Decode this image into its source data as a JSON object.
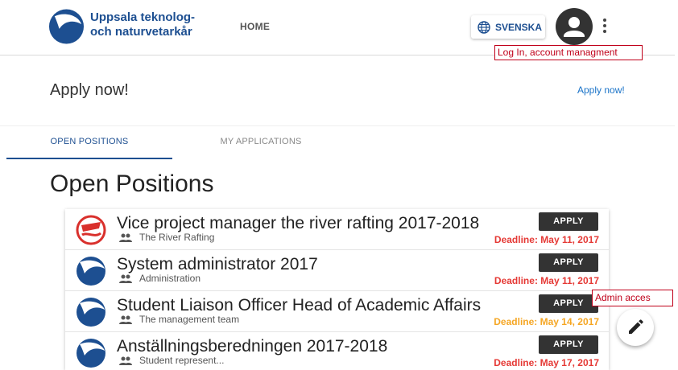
{
  "header": {
    "brand_line1": "Uppsala teknolog-",
    "brand_line2": "och naturvetarkår",
    "nav_home": "HOME",
    "lang_button": "SVENSKA",
    "brand_color": "#1d4f91"
  },
  "annotations": {
    "login": "Log In, account managment",
    "admin": "Admin acces"
  },
  "apply_bar": {
    "title": "Apply now!",
    "link": "Apply now!"
  },
  "tabs": [
    {
      "label": "OPEN POSITIONS",
      "active": true
    },
    {
      "label": "MY APPLICATIONS",
      "active": false
    }
  ],
  "section_title": "Open Positions",
  "positions": [
    {
      "title": "Vice project manager the river rafting 2017-2018",
      "group": "The River Rafting",
      "apply": "APPLY",
      "deadline": "Deadline: May 11, 2017",
      "deadline_color": "#e53935",
      "icon": "river-rafting-icon"
    },
    {
      "title": "System administrator 2017",
      "group": "Administration",
      "apply": "APPLY",
      "deadline": "Deadline: May 11, 2017",
      "deadline_color": "#e53935",
      "icon": "utn-logo-icon"
    },
    {
      "title": "Student Liaison Officer Head of Academic Affairs",
      "group": "The management team",
      "apply": "APPLY",
      "deadline": "Deadline: May 14, 2017",
      "deadline_color": "#f5a623",
      "icon": "utn-logo-icon"
    },
    {
      "title": "Anställningsberedningen 2017-2018",
      "group": "Student represent...",
      "apply": "APPLY",
      "deadline": "Deadline: May 17, 2017",
      "deadline_color": "#e53935",
      "icon": "utn-logo-icon"
    }
  ]
}
